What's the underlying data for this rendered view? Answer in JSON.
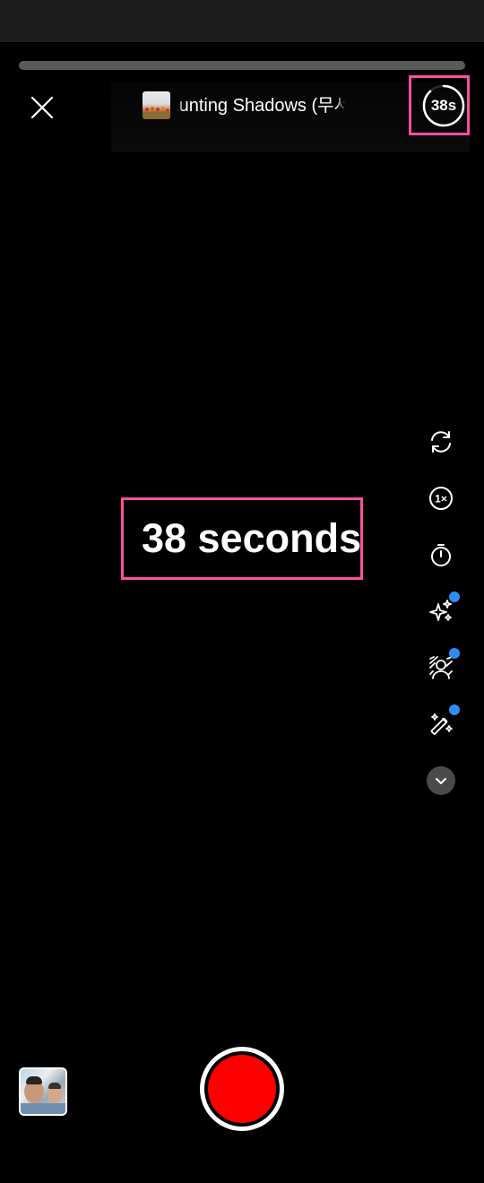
{
  "music": {
    "title": "Haunting Shadows (무서"
  },
  "timer": {
    "label": "38s",
    "progress": 0.88
  },
  "countdown_overlay": {
    "text": "38 seconds"
  },
  "tools": [
    {
      "icon": "flip-camera-icon",
      "has_badge": false
    },
    {
      "icon": "speed-1x-icon",
      "has_badge": false
    },
    {
      "icon": "stopwatch-icon",
      "has_badge": false
    },
    {
      "icon": "sparkles-effects-icon",
      "has_badge": true
    },
    {
      "icon": "green-screen-person-icon",
      "has_badge": true
    },
    {
      "icon": "magic-wand-icon",
      "has_badge": true
    },
    {
      "icon": "chevron-down-icon",
      "has_badge": false
    }
  ],
  "colors": {
    "record": "#ff0000",
    "badge": "#2f8cf6",
    "highlight": "#ff4fa0"
  }
}
